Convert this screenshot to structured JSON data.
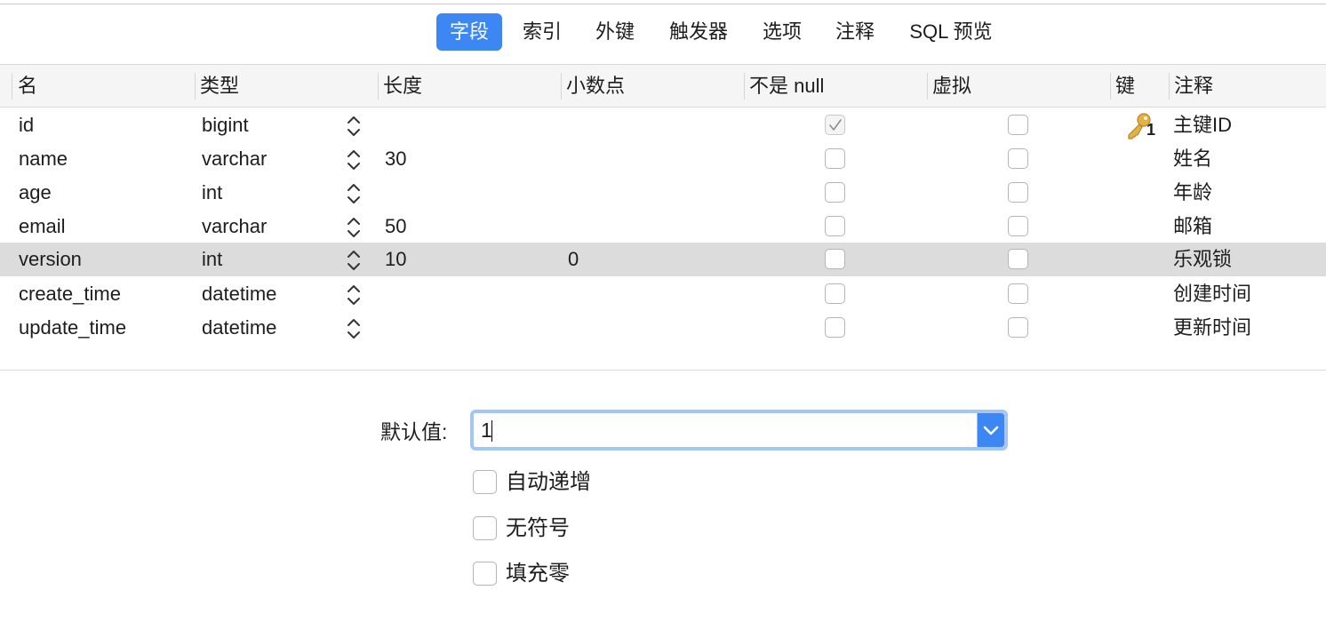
{
  "tabs": [
    {
      "label": "字段",
      "active": true
    },
    {
      "label": "索引",
      "active": false
    },
    {
      "label": "外键",
      "active": false
    },
    {
      "label": "触发器",
      "active": false
    },
    {
      "label": "选项",
      "active": false
    },
    {
      "label": "注释",
      "active": false
    },
    {
      "label": "SQL 预览",
      "active": false
    }
  ],
  "columns": [
    "名",
    "类型",
    "长度",
    "小数点",
    "不是 null",
    "虚拟",
    "键",
    "注释"
  ],
  "fields": [
    {
      "name": "id",
      "type": "bigint",
      "length": "",
      "decimals": "",
      "not_null": true,
      "virtual": false,
      "key": "1",
      "comment": "主键ID"
    },
    {
      "name": "name",
      "type": "varchar",
      "length": "30",
      "decimals": "",
      "not_null": false,
      "virtual": false,
      "key": "",
      "comment": "姓名"
    },
    {
      "name": "age",
      "type": "int",
      "length": "",
      "decimals": "",
      "not_null": false,
      "virtual": false,
      "key": "",
      "comment": "年龄"
    },
    {
      "name": "email",
      "type": "varchar",
      "length": "50",
      "decimals": "",
      "not_null": false,
      "virtual": false,
      "key": "",
      "comment": "邮箱"
    },
    {
      "name": "version",
      "type": "int",
      "length": "10",
      "decimals": "0",
      "not_null": false,
      "virtual": false,
      "key": "",
      "comment": "乐观锁",
      "selected": true
    },
    {
      "name": "create_time",
      "type": "datetime",
      "length": "",
      "decimals": "",
      "not_null": false,
      "virtual": false,
      "key": "",
      "comment": "创建时间"
    },
    {
      "name": "update_time",
      "type": "datetime",
      "length": "",
      "decimals": "",
      "not_null": false,
      "virtual": false,
      "key": "",
      "comment": "更新时间"
    }
  ],
  "default_value": {
    "label": "默认值:",
    "value": "1"
  },
  "options": [
    {
      "label": "自动递增",
      "checked": false
    },
    {
      "label": "无符号",
      "checked": false
    },
    {
      "label": "填充零",
      "checked": false
    }
  ],
  "colors": {
    "accent": "#3d87f5",
    "selected_row": "#dcdcdc",
    "key_icon": "#e2b245"
  }
}
